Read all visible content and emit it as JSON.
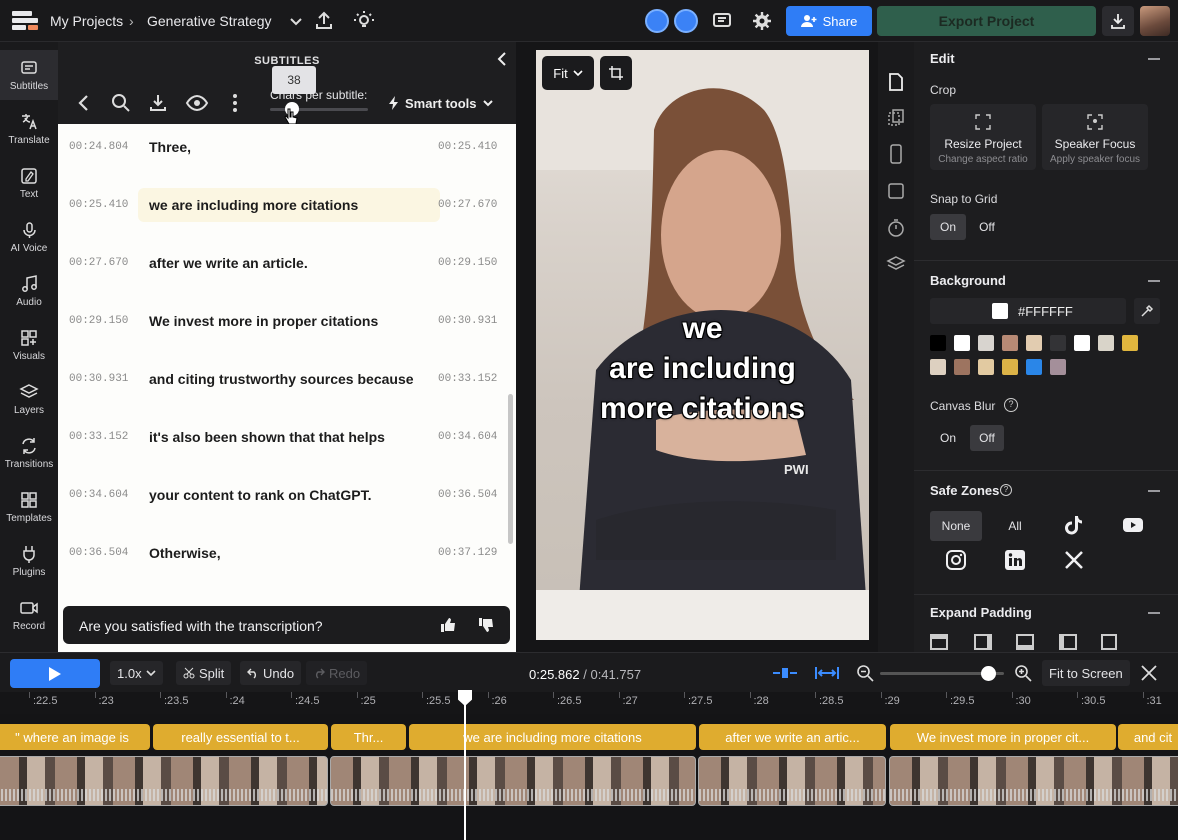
{
  "topbar": {
    "breadcrumb_root": "My Projects",
    "project_name": "Generative Strategy",
    "share_label": "Share",
    "export_label": "Export Project"
  },
  "rail": {
    "items": [
      {
        "label": "Subtitles",
        "icon": "subtitles-icon"
      },
      {
        "label": "Translate",
        "icon": "translate-icon"
      },
      {
        "label": "Text",
        "icon": "text-icon"
      },
      {
        "label": "AI Voice",
        "icon": "ai-voice-icon"
      },
      {
        "label": "Audio",
        "icon": "audio-icon"
      },
      {
        "label": "Visuals",
        "icon": "visuals-icon"
      },
      {
        "label": "Layers",
        "icon": "layers-icon"
      },
      {
        "label": "Transitions",
        "icon": "transitions-icon"
      },
      {
        "label": "Templates",
        "icon": "templates-icon"
      },
      {
        "label": "Plugins",
        "icon": "plugins-icon"
      },
      {
        "label": "Record",
        "icon": "record-icon"
      }
    ]
  },
  "subtitles": {
    "title": "SUBTITLES",
    "chars_label": "Chars per subtitle:",
    "chars_value": "38",
    "smart_tools": "Smart tools",
    "rows": [
      {
        "start": "00:24.804",
        "text": "Three,",
        "end": "00:25.410"
      },
      {
        "start": "00:25.410",
        "text": "we are including more citations",
        "end": "00:27.670"
      },
      {
        "start": "00:27.670",
        "text": "after we write an article.",
        "end": "00:29.150"
      },
      {
        "start": "00:29.150",
        "text": "We invest more in proper citations",
        "end": "00:30.931"
      },
      {
        "start": "00:30.931",
        "text": "and citing trustworthy sources because",
        "end": "00:33.152"
      },
      {
        "start": "00:33.152",
        "text": "it's also been shown that that helps",
        "end": "00:34.604"
      },
      {
        "start": "00:34.604",
        "text": "your content to rank on ChatGPT.",
        "end": "00:36.504"
      },
      {
        "start": "00:36.504",
        "text": "Otherwise,",
        "end": "00:37.129"
      }
    ],
    "satisfied_prompt": "Are you satisfied with the transcription?"
  },
  "preview": {
    "fit_label": "Fit",
    "caption_lines": [
      "we",
      "are including",
      "more citations"
    ],
    "shirt_text": "PWI"
  },
  "edit": {
    "title": "Edit",
    "crop_label": "Crop",
    "resize_title": "Resize Project",
    "resize_sub": "Change aspect ratio",
    "speaker_title": "Speaker Focus",
    "speaker_sub": "Apply speaker focus",
    "snap_label": "Snap to Grid",
    "on": "On",
    "off": "Off",
    "background_label": "Background",
    "bg_hex": "#FFFFFF",
    "swatches": [
      "#000000",
      "#ffffff",
      "#d8d4cf",
      "#b88a75",
      "#e2ccb0",
      "#333336",
      "#ffffff",
      "#d9d4c9",
      "#e0b63e",
      "#ddd0c0",
      "#9d7460",
      "#e2caa1",
      "#dcb347",
      "#2a86e8",
      "#a48f9a"
    ],
    "canvas_blur_label": "Canvas Blur",
    "safe_zones_label": "Safe Zones",
    "safe_none": "None",
    "safe_all": "All",
    "expand_padding_label": "Expand Padding"
  },
  "timeline": {
    "speed": "1.0x",
    "split": "Split",
    "undo": "Undo",
    "redo": "Redo",
    "current_time": "0:25.862",
    "total_time": "0:41.757",
    "fit_screen": "Fit to Screen",
    "ticks": [
      ":22.5",
      ":23",
      ":23.5",
      ":24",
      ":24.5",
      ":25",
      ":25.5",
      ":26",
      ":26.5",
      ":27",
      ":27.5",
      ":28",
      ":28.5",
      ":29",
      ":29.5",
      ":30",
      ":30.5",
      ":31"
    ],
    "clips": [
      "\" where an image is",
      "really essential to t...",
      "Thr...",
      "we are including more citations",
      "after we write an artic...",
      "We invest more in proper cit...",
      "and cit"
    ]
  },
  "colors": {
    "accent": "#2f7df6",
    "export": "#2f5f4c",
    "caption_clip": "#dfac2f"
  }
}
